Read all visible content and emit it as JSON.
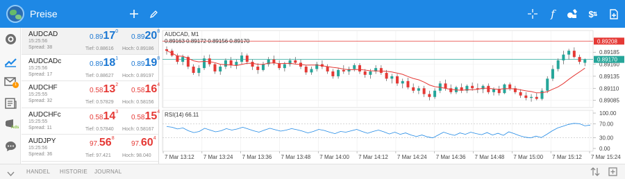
{
  "app": {
    "title": "Preise"
  },
  "toolbar": {
    "left_icons": [
      "plus-icon",
      "pencil-icon"
    ],
    "right_icons": [
      "crosshair-icon",
      "function-icon",
      "objects-icon",
      "dollar-arrows-icon",
      "add-document-icon"
    ]
  },
  "sidebar": {
    "icons": [
      "profile-icon",
      "chart-icon",
      "mail-icon",
      "news-icon",
      "ads-icon",
      "chat-icon"
    ],
    "mail_badge": "1",
    "ads_label": "Ads"
  },
  "quotes": [
    {
      "symbol": "AUDCAD",
      "time": "15:25:56",
      "spread": "Spread: 38",
      "bid": {
        "pre": "0.89",
        "big": "17",
        "sup": "0"
      },
      "ask": {
        "pre": "0.89",
        "big": "20",
        "sup": "8"
      },
      "bid_color": "blue",
      "ask_color": "blue",
      "low": "Tief: 0.88616",
      "high": "Hoch: 0.89186"
    },
    {
      "symbol": "AUDCADc",
      "time": "15:25:56",
      "spread": "Spread: 17",
      "bid": {
        "pre": "0.89",
        "big": "18",
        "sup": "1"
      },
      "ask": {
        "pre": "0.89",
        "big": "19",
        "sup": "8"
      },
      "bid_color": "blue",
      "ask_color": "blue",
      "low": "Tief: 0.88627",
      "high": "Hoch: 0.89197"
    },
    {
      "symbol": "AUDCHF",
      "time": "15:25:55",
      "spread": "Spread: 32",
      "bid": {
        "pre": "0.58",
        "big": "13",
        "sup": "2"
      },
      "ask": {
        "pre": "0.58",
        "big": "16",
        "sup": "4"
      },
      "bid_color": "red",
      "ask_color": "red",
      "low": "Tief: 0.57829",
      "high": "Hoch: 0.58156"
    },
    {
      "symbol": "AUDCHFc",
      "time": "15:25:55",
      "spread": "Spread: 11",
      "bid": {
        "pre": "0.58",
        "big": "14",
        "sup": "3"
      },
      "ask": {
        "pre": "0.58",
        "big": "15",
        "sup": "4"
      },
      "bid_color": "red",
      "ask_color": "red",
      "low": "Tief: 0.57840",
      "high": "Hoch: 0.58167"
    },
    {
      "symbol": "AUDJPY",
      "time": "15:25:56",
      "spread": "Spread: 36",
      "bid": {
        "pre": "97.",
        "big": "56",
        "sup": "8"
      },
      "ask": {
        "pre": "97.",
        "big": "60",
        "sup": "4"
      },
      "bid_color": "red",
      "ask_color": "red",
      "low": "Tief: 97.421",
      "high": "Hoch: 98.040"
    }
  ],
  "chart_data": {
    "type": "candlestick",
    "symbol_label": "AUDCAD, M1",
    "ohlc_label": "0.89163 0.89172 0.89156 0.89170",
    "price_axis": {
      "ticks": [
        "0.89185",
        "0.89160",
        "0.89135",
        "0.89110",
        "0.89085"
      ],
      "range": [
        0.8907,
        0.8923
      ]
    },
    "ask_line": {
      "label": "0.89208",
      "value": 0.89208,
      "color": "#e53935"
    },
    "bid_line": {
      "label": "0.89170",
      "value": 0.8917,
      "color": "#26a69a"
    },
    "time_axis": [
      "7 Mar 13:12",
      "7 Mar 13:24",
      "7 Mar 13:36",
      "7 Mar 13:48",
      "7 Mar 14:00",
      "7 Mar 14:12",
      "7 Mar 14:24",
      "7 Mar 14:36",
      "7 Mar 14:48",
      "7 Mar 15:00",
      "7 Mar 15:12",
      "7 Mar 15:24"
    ],
    "candles": [
      [
        0.89191,
        0.89197,
        0.8918,
        0.89188
      ],
      [
        0.89188,
        0.89192,
        0.89175,
        0.89178
      ],
      [
        0.89178,
        0.89182,
        0.8916,
        0.89165
      ],
      [
        0.89165,
        0.8918,
        0.89158,
        0.89175
      ],
      [
        0.89175,
        0.89178,
        0.8915,
        0.89155
      ],
      [
        0.89155,
        0.8916,
        0.89138,
        0.89142
      ],
      [
        0.89142,
        0.89158,
        0.89135,
        0.89152
      ],
      [
        0.89152,
        0.89178,
        0.89148,
        0.89172
      ],
      [
        0.89172,
        0.8918,
        0.89155,
        0.8916
      ],
      [
        0.8916,
        0.89162,
        0.8914,
        0.89145
      ],
      [
        0.89145,
        0.8916,
        0.89138,
        0.89155
      ],
      [
        0.89155,
        0.89172,
        0.8915,
        0.89168
      ],
      [
        0.89168,
        0.89175,
        0.89152,
        0.89158
      ],
      [
        0.89158,
        0.8917,
        0.8915,
        0.89165
      ],
      [
        0.89165,
        0.89185,
        0.8916,
        0.89178
      ],
      [
        0.89178,
        0.89182,
        0.8916,
        0.89165
      ],
      [
        0.89165,
        0.8917,
        0.89148,
        0.89155
      ],
      [
        0.89155,
        0.89162,
        0.8914,
        0.89148
      ],
      [
        0.89148,
        0.89165,
        0.89145,
        0.8916
      ],
      [
        0.8916,
        0.89175,
        0.89155,
        0.8917
      ],
      [
        0.8917,
        0.89178,
        0.89158,
        0.89162
      ],
      [
        0.89162,
        0.89168,
        0.89148,
        0.89152
      ],
      [
        0.89152,
        0.89165,
        0.89145,
        0.8916
      ],
      [
        0.8916,
        0.89172,
        0.89155,
        0.89168
      ],
      [
        0.89168,
        0.89175,
        0.8916,
        0.89163
      ],
      [
        0.89163,
        0.8917,
        0.8915,
        0.89155
      ],
      [
        0.89155,
        0.89158,
        0.89138,
        0.89143
      ],
      [
        0.89143,
        0.89155,
        0.89138,
        0.8915
      ],
      [
        0.8915,
        0.89165,
        0.89145,
        0.8916
      ],
      [
        0.8916,
        0.89168,
        0.8915,
        0.89155
      ],
      [
        0.89155,
        0.8916,
        0.8914,
        0.89145
      ],
      [
        0.89145,
        0.8915,
        0.8913,
        0.89135
      ],
      [
        0.89135,
        0.89152,
        0.8913,
        0.89148
      ],
      [
        0.89148,
        0.89158,
        0.8914,
        0.89145
      ],
      [
        0.89145,
        0.89155,
        0.89138,
        0.8915
      ],
      [
        0.8915,
        0.89162,
        0.89145,
        0.89158
      ],
      [
        0.89158,
        0.89162,
        0.8914,
        0.89145
      ],
      [
        0.89145,
        0.8915,
        0.89132,
        0.89138
      ],
      [
        0.89138,
        0.8915,
        0.8913,
        0.89145
      ],
      [
        0.89145,
        0.89158,
        0.8914,
        0.89152
      ],
      [
        0.89152,
        0.89158,
        0.89138,
        0.89142
      ],
      [
        0.89142,
        0.89148,
        0.89125,
        0.8913
      ],
      [
        0.8913,
        0.8914,
        0.8912,
        0.89135
      ],
      [
        0.89135,
        0.8914,
        0.89115,
        0.8912
      ],
      [
        0.8912,
        0.8913,
        0.8911,
        0.89125
      ],
      [
        0.89125,
        0.89132,
        0.89108,
        0.89112
      ],
      [
        0.89112,
        0.8912,
        0.891,
        0.89105
      ],
      [
        0.89105,
        0.89115,
        0.89098,
        0.8911
      ],
      [
        0.8911,
        0.89115,
        0.89092,
        0.89098
      ],
      [
        0.89098,
        0.89105,
        0.89085,
        0.89092
      ],
      [
        0.89092,
        0.8911,
        0.89088,
        0.89105
      ],
      [
        0.89105,
        0.89125,
        0.891,
        0.8912
      ],
      [
        0.8912,
        0.89128,
        0.89105,
        0.8911
      ],
      [
        0.8911,
        0.89118,
        0.89098,
        0.89102
      ],
      [
        0.89102,
        0.89115,
        0.89098,
        0.89112
      ],
      [
        0.89112,
        0.8912,
        0.891,
        0.89105
      ],
      [
        0.89105,
        0.89118,
        0.891,
        0.89115
      ],
      [
        0.89115,
        0.89122,
        0.89105,
        0.8911
      ],
      [
        0.8911,
        0.8912,
        0.891,
        0.89108
      ],
      [
        0.89108,
        0.89118,
        0.891,
        0.89115
      ],
      [
        0.89115,
        0.8912,
        0.89098,
        0.89102
      ],
      [
        0.89102,
        0.89112,
        0.89095,
        0.89108
      ],
      [
        0.89108,
        0.89115,
        0.89095,
        0.891
      ],
      [
        0.891,
        0.8912,
        0.89098,
        0.89118
      ],
      [
        0.89118,
        0.89122,
        0.89105,
        0.8911
      ],
      [
        0.8911,
        0.89115,
        0.89098,
        0.89102
      ],
      [
        0.89102,
        0.89108,
        0.8909,
        0.89095
      ],
      [
        0.89095,
        0.89102,
        0.89085,
        0.8909
      ],
      [
        0.8909,
        0.89098,
        0.89082,
        0.89092
      ],
      [
        0.89092,
        0.891,
        0.89085,
        0.89088
      ],
      [
        0.89088,
        0.8911,
        0.89085,
        0.89105
      ],
      [
        0.89105,
        0.89135,
        0.891,
        0.8913
      ],
      [
        0.8913,
        0.89158,
        0.89125,
        0.8915
      ],
      [
        0.8915,
        0.89172,
        0.89145,
        0.89168
      ],
      [
        0.89168,
        0.89188,
        0.8916,
        0.8918
      ],
      [
        0.8918,
        0.89192,
        0.8917,
        0.89188
      ],
      [
        0.89188,
        0.89195,
        0.89172,
        0.89175
      ],
      [
        0.89175,
        0.8918,
        0.8916,
        0.89165
      ],
      [
        0.89163,
        0.89172,
        0.89156,
        0.8917
      ]
    ],
    "rsi": {
      "label": "RSI(14) 66.11",
      "ticks": [
        "100.00",
        "70.00",
        "30.00",
        "0.00"
      ],
      "levels": [
        70,
        30
      ],
      "range": [
        0,
        100
      ],
      "values": [
        62,
        60,
        55,
        58,
        50,
        45,
        48,
        57,
        52,
        47,
        50,
        56,
        52,
        55,
        60,
        55,
        50,
        46,
        52,
        57,
        53,
        49,
        52,
        56,
        53,
        49,
        44,
        48,
        54,
        51,
        46,
        42,
        48,
        46,
        50,
        54,
        48,
        43,
        48,
        52,
        47,
        41,
        46,
        40,
        44,
        38,
        34,
        38,
        33,
        30,
        38,
        46,
        41,
        37,
        44,
        40,
        46,
        42,
        39,
        45,
        38,
        43,
        37,
        47,
        42,
        36,
        32,
        30,
        35,
        31,
        40,
        50,
        58,
        63,
        68,
        71,
        70,
        64,
        66
      ]
    }
  },
  "bottombar": {
    "tabs": [
      "HANDEL",
      "HISTORIE",
      "JOURNAL"
    ]
  }
}
